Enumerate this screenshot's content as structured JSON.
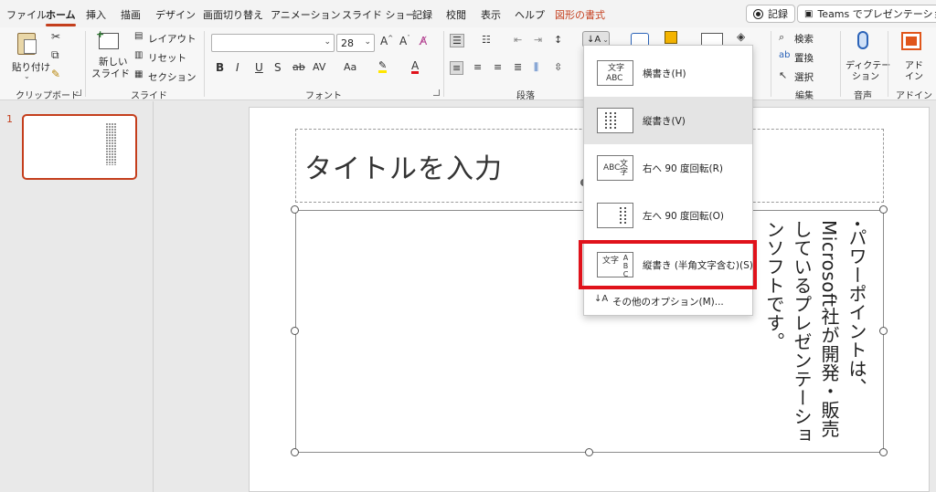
{
  "menubar": {
    "tabs": [
      {
        "label": "ファイル",
        "active": false
      },
      {
        "label": "ホーム",
        "active": true
      },
      {
        "label": "挿入",
        "active": false
      },
      {
        "label": "描画",
        "active": false
      },
      {
        "label": "デザイン",
        "active": false
      },
      {
        "label": "画面切り替え",
        "active": false
      },
      {
        "label": "アニメーション",
        "active": false
      },
      {
        "label": "スライド ショー",
        "active": false
      },
      {
        "label": "記録",
        "active": false
      },
      {
        "label": "校閲",
        "active": false
      },
      {
        "label": "表示",
        "active": false
      },
      {
        "label": "ヘルプ",
        "active": false
      },
      {
        "label": "図形の書式",
        "active": false,
        "contextual": true
      }
    ],
    "record_button": "記録",
    "teams_button": "Teams でプレゼンテーション"
  },
  "ribbon": {
    "clipboard": {
      "paste": "貼り付け",
      "group": "クリップボード"
    },
    "slides": {
      "new_slide_line1": "新しい",
      "new_slide_line2": "スライド",
      "layout": "レイアウト",
      "reset": "リセット",
      "section": "セクション",
      "group": "スライド"
    },
    "font": {
      "font_name": "",
      "font_size": "28",
      "group": "フォント",
      "bold": "B",
      "italic": "I",
      "underline": "U",
      "shadow": "S",
      "strike": "ab",
      "spacing": "AV",
      "case": "Aa",
      "grow": "A",
      "shrink": "A"
    },
    "paragraph": {
      "group": "段落"
    },
    "editing": {
      "find": "検索",
      "replace": "置換",
      "select": "選択",
      "group": "編集"
    },
    "voice": {
      "dictate_line1": "ディクテー",
      "dictate_line2": "ション",
      "group": "音声"
    },
    "designer": {
      "line1": "アド",
      "line2": "イン",
      "group": "アドイン"
    }
  },
  "thumbnails": {
    "slide_number": "1"
  },
  "slide": {
    "title": "タイトルを入力",
    "bullet": "•",
    "content_lines": [
      "パワーポイントは、",
      "Microsoft社が開発・販売",
      "しているプレゼンテー",
      "ションソフトです。"
    ]
  },
  "text_direction_menu": {
    "items": [
      {
        "label": "横書き(H)",
        "icon_text_top": "文字",
        "icon_text_bottom": "ABC"
      },
      {
        "label": "縦書き(V)",
        "hover": true
      },
      {
        "label": "右へ 90 度回転(R)",
        "icon_text_top": "文字",
        "icon_text_bottom": "ABC"
      },
      {
        "label": "左へ 90 度回転(O)"
      },
      {
        "label": "縦書き (半角文字含む)(S)",
        "icon_text_top": "文字",
        "icon_text_bottom": "ABC",
        "highlighted": true
      }
    ],
    "more_options": "その他のオプション(M)..."
  },
  "colors": {
    "accent": "#c43e1c",
    "highlight_box": "#e0121b"
  }
}
